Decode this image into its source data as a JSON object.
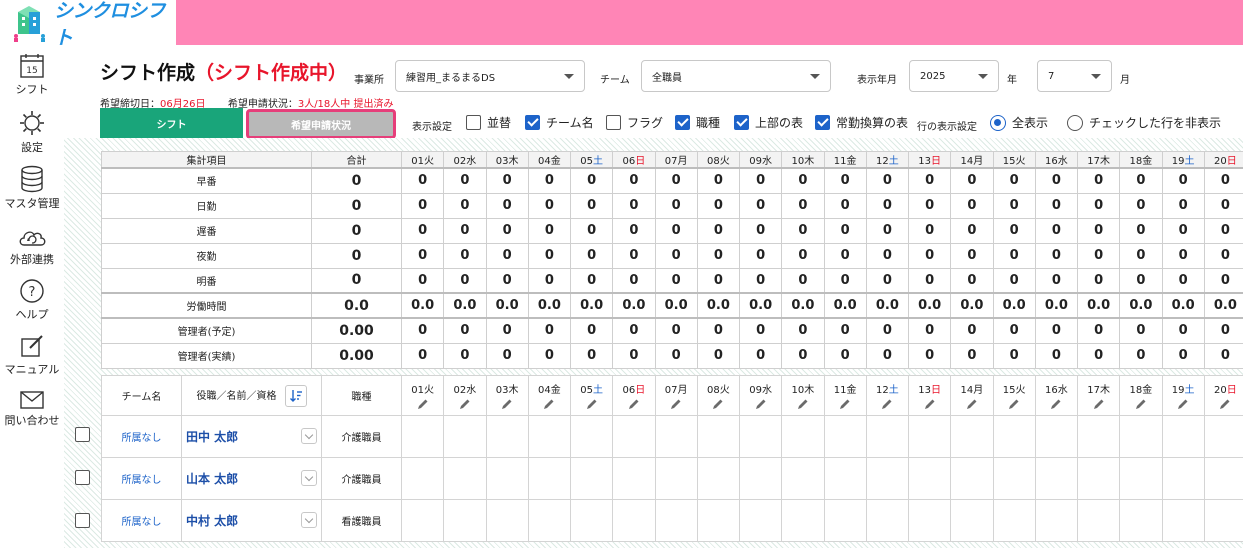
{
  "app": {
    "name": "シンクロシフト"
  },
  "sidebar": {
    "items": [
      {
        "label": "シフト",
        "icon": "calendar-icon",
        "day": "15"
      },
      {
        "label": "設定",
        "icon": "gear-icon"
      },
      {
        "label": "マスタ管理",
        "icon": "database-icon"
      },
      {
        "label": "外部連携",
        "icon": "cloud-sync-icon"
      },
      {
        "label": "ヘルプ",
        "icon": "help-icon"
      },
      {
        "label": "マニュアル",
        "icon": "edit-icon"
      },
      {
        "label": "問い合わせ",
        "icon": "mail-icon"
      }
    ]
  },
  "header": {
    "title": "シフト作成",
    "status": "（シフト作成中）",
    "office_label": "事業所",
    "office_value": "練習用_まるまるDS",
    "team_label": "チーム",
    "team_value": "全職員",
    "period_label": "表示年月",
    "year_value": "2025",
    "year_unit": "年",
    "month_value": "7",
    "month_unit": "月",
    "deadline_label": "希望締切日：",
    "deadline_value": "06月26日",
    "request_label": "希望申請状況：",
    "request_value": "3人/18人中 提出済み"
  },
  "tabs": {
    "shift": "シフト",
    "request": "希望申請状況"
  },
  "display_settings": {
    "label": "表示設定",
    "options": [
      {
        "label": "並替",
        "checked": false
      },
      {
        "label": "チーム名",
        "checked": true
      },
      {
        "label": "フラグ",
        "checked": false
      },
      {
        "label": "職種",
        "checked": true
      },
      {
        "label": "上部の表",
        "checked": true
      },
      {
        "label": "常勤換算の表",
        "checked": true
      }
    ],
    "row_label": "行の表示設定",
    "radio_all": "全表示",
    "radio_hide": "チェックした行を非表示"
  },
  "days": [
    {
      "d": "01",
      "w": "火"
    },
    {
      "d": "02",
      "w": "水"
    },
    {
      "d": "03",
      "w": "木"
    },
    {
      "d": "04",
      "w": "金"
    },
    {
      "d": "05",
      "w": "土"
    },
    {
      "d": "06",
      "w": "日"
    },
    {
      "d": "07",
      "w": "月"
    },
    {
      "d": "08",
      "w": "火"
    },
    {
      "d": "09",
      "w": "水"
    },
    {
      "d": "10",
      "w": "木"
    },
    {
      "d": "11",
      "w": "金"
    },
    {
      "d": "12",
      "w": "土"
    },
    {
      "d": "13",
      "w": "日"
    },
    {
      "d": "14",
      "w": "月"
    },
    {
      "d": "15",
      "w": "火"
    },
    {
      "d": "16",
      "w": "水"
    },
    {
      "d": "17",
      "w": "木"
    },
    {
      "d": "18",
      "w": "金"
    },
    {
      "d": "19",
      "w": "土"
    },
    {
      "d": "20",
      "w": "日"
    }
  ],
  "summary": {
    "header_item": "集計項目",
    "header_total": "合計",
    "rows": [
      {
        "label": "早番",
        "total": "0",
        "value": "0"
      },
      {
        "label": "日勤",
        "total": "0",
        "value": "0"
      },
      {
        "label": "遅番",
        "total": "0",
        "value": "0"
      },
      {
        "label": "夜勤",
        "total": "0",
        "value": "0"
      },
      {
        "label": "明番",
        "total": "0",
        "value": "0"
      },
      {
        "label": "労働時間",
        "total": "0.0",
        "value": "0.0"
      },
      {
        "label": "管理者(予定)",
        "total": "0.00",
        "value": "0"
      },
      {
        "label": "管理者(実績)",
        "total": "0.00",
        "value": "0"
      }
    ]
  },
  "staff_table": {
    "col_team": "チーム名",
    "col_name": "役職／名前／資格",
    "col_job": "職種",
    "rows": [
      {
        "team": "所属なし",
        "name": "田中 太郎",
        "job": "介護職員"
      },
      {
        "team": "所属なし",
        "name": "山本 太郎",
        "job": "介護職員"
      },
      {
        "team": "所属なし",
        "name": "中村 太郎",
        "job": "看護職員"
      }
    ]
  }
}
